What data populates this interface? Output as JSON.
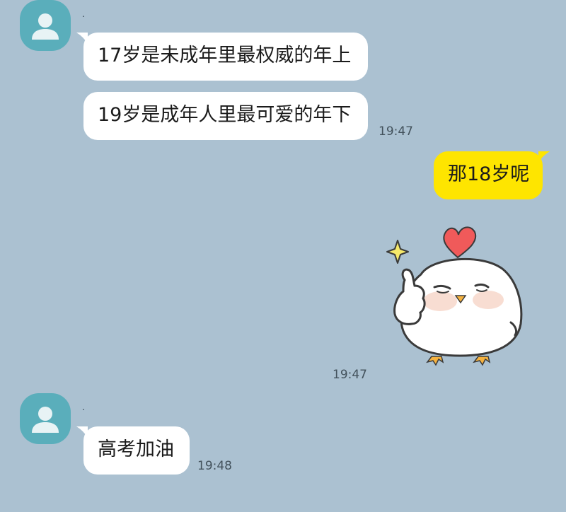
{
  "colors": {
    "background": "#abc1d1",
    "avatar": "#5aaebb",
    "received_bubble": "#ffffff",
    "sent_bubble": "#fee500"
  },
  "messages": {
    "group1": {
      "sender": ".",
      "bubble1": "17岁是未成年里最权威的年上",
      "bubble2": "19岁是成年人里最可爱的年下",
      "time": "19:47"
    },
    "sent": {
      "text": "那18岁呢"
    },
    "sticker": {
      "icon": "chick-thumbs-up-sticker",
      "time": "19:47"
    },
    "group2": {
      "sender": ".",
      "bubble1": "高考加油",
      "time": "19:48"
    }
  }
}
